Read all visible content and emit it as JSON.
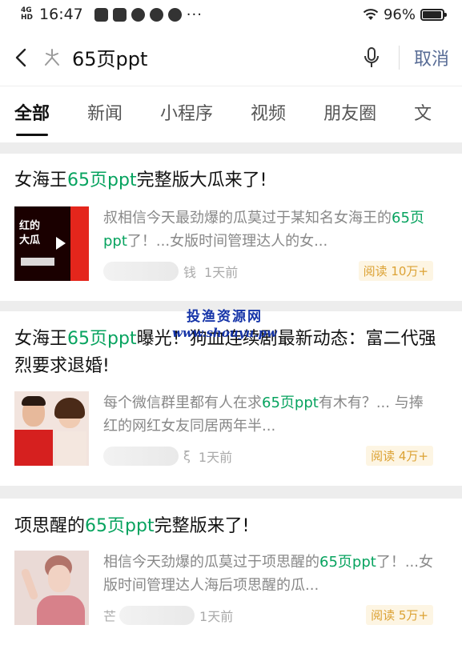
{
  "status_bar": {
    "network_top": "4G",
    "network_bottom": "HD",
    "time": "16:47",
    "more": "···",
    "battery": "96%",
    "battery_level": 0.96
  },
  "search": {
    "query": "65页ppt",
    "cancel_label": "取消"
  },
  "tabs": [
    {
      "label": "全部",
      "active": true
    },
    {
      "label": "新闻",
      "active": false
    },
    {
      "label": "小程序",
      "active": false
    },
    {
      "label": "视频",
      "active": false
    },
    {
      "label": "朋友圈",
      "active": false
    },
    {
      "label": "文",
      "active": false
    }
  ],
  "results": [
    {
      "title_parts": [
        "女海王",
        "65页ppt",
        "完整版大瓜来了!"
      ],
      "summary_parts": [
        "叔相信今天最劲爆的瓜莫过于某知名女海王的",
        "65页ppt",
        "了！...女版时间管理达人的女..."
      ],
      "thumb_text": [
        "红的",
        "大瓜"
      ],
      "source_tail": "钱",
      "time": "1天前",
      "reads": "阅读 10万+"
    },
    {
      "title_parts": [
        "女海王",
        "65页ppt",
        "曝光！狗血连续剧最新动态：富二代强烈要求退婚!"
      ],
      "summary_parts": [
        "每个微信群里都有人在求",
        "65页ppt",
        "有木有？... 与捧红的网红女友同居两年半..."
      ],
      "thumb_text": [],
      "source_tail": "ξ",
      "time": "1天前",
      "reads": "阅读 4万+"
    },
    {
      "title_parts": [
        "项思醒的",
        "65页ppt",
        "完整版来了!"
      ],
      "summary_parts": [
        "相信今天劲爆的瓜莫过于项思醒的",
        "65页ppt",
        "了！...女版时间管理达人海后项思醒的瓜..."
      ],
      "thumb_text": [],
      "source_tail": "芒",
      "time": "1天前",
      "reads": "阅读 5万+"
    }
  ],
  "watermark": {
    "line1": "投渔资源网",
    "line2": "www.shouyu.pw"
  },
  "colors": {
    "highlight": "#07a35f",
    "cancel": "#576b95",
    "reads_bg": "#fdf5e3",
    "reads_text": "#dca234"
  }
}
